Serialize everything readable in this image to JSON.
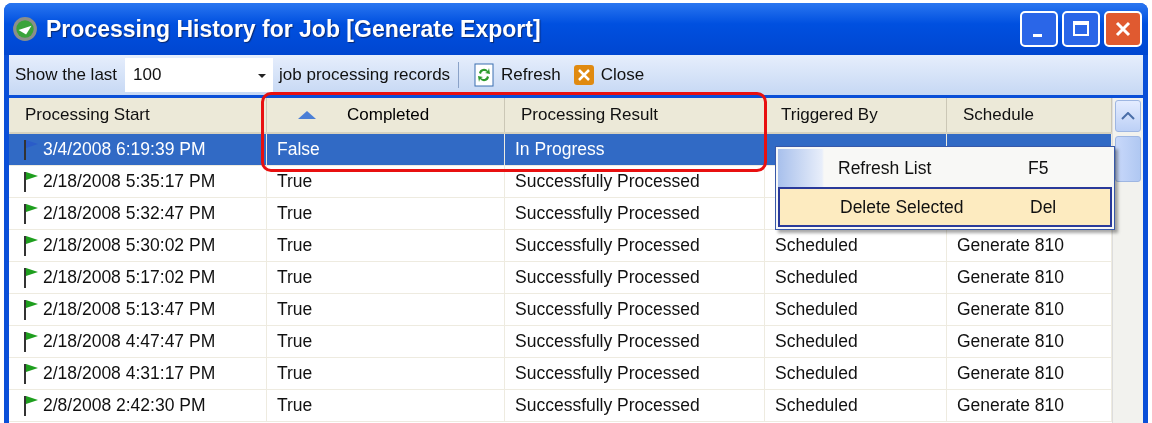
{
  "window": {
    "title": "Processing History for Job [Generate Export]"
  },
  "toolbar": {
    "show_label": "Show the last",
    "count": {
      "value": "100"
    },
    "records_label": "job processing records",
    "buttons": [
      {
        "kind": "refresh",
        "label": "Refresh"
      },
      {
        "kind": "close",
        "label": "Close"
      }
    ]
  },
  "table": {
    "columns": [
      {
        "label": "Processing Start",
        "sorted": false
      },
      {
        "label": "Completed",
        "sorted": true
      },
      {
        "label": "Processing Result",
        "sorted": false
      },
      {
        "label": "Triggered By",
        "sorted": false
      },
      {
        "label": "Schedule",
        "sorted": false
      }
    ],
    "rows": [
      {
        "start": "3/4/2008 6:19:39 PM",
        "completed": "False",
        "result": "In Progress",
        "selected": true,
        "color": "#2a5cc8"
      },
      {
        "start": "2/18/2008 5:35:17 PM",
        "completed": "True",
        "result": "Successfully Processed",
        "selected": false,
        "color": "#1e9e1e"
      },
      {
        "start": "2/18/2008 5:32:47 PM",
        "completed": "True",
        "result": "Successfully Processed",
        "selected": false,
        "color": "#1e9e1e"
      },
      {
        "start": "2/18/2008 5:30:02 PM",
        "completed": "True",
        "result": "Successfully Processed",
        "triggered_by": "Scheduled",
        "schedule": "Generate 810",
        "selected": false,
        "color": "#1e9e1e"
      },
      {
        "start": "2/18/2008 5:17:02 PM",
        "completed": "True",
        "result": "Successfully Processed",
        "triggered_by": "Scheduled",
        "schedule": "Generate 810",
        "selected": false,
        "color": "#1e9e1e"
      },
      {
        "start": "2/18/2008 5:13:47 PM",
        "completed": "True",
        "result": "Successfully Processed",
        "triggered_by": "Scheduled",
        "schedule": "Generate 810",
        "selected": false,
        "color": "#1e9e1e"
      },
      {
        "start": "2/18/2008 4:47:47 PM",
        "completed": "True",
        "result": "Successfully Processed",
        "triggered_by": "Scheduled",
        "schedule": "Generate 810",
        "selected": false,
        "color": "#1e9e1e"
      },
      {
        "start": "2/18/2008 4:31:17 PM",
        "completed": "True",
        "result": "Successfully Processed",
        "triggered_by": "Scheduled",
        "schedule": "Generate 810",
        "selected": false,
        "color": "#1e9e1e"
      },
      {
        "start": "2/8/2008 2:42:30 PM",
        "completed": "True",
        "result": "Successfully Processed",
        "triggered_by": "Scheduled",
        "schedule": "Generate 810",
        "selected": false,
        "color": "#1e9e1e"
      }
    ]
  },
  "context_menu": {
    "items": [
      {
        "label": "Refresh List",
        "shortcut": "F5",
        "selected": false
      },
      {
        "label": "Delete Selected",
        "shortcut": "Del",
        "selected": true
      }
    ]
  }
}
